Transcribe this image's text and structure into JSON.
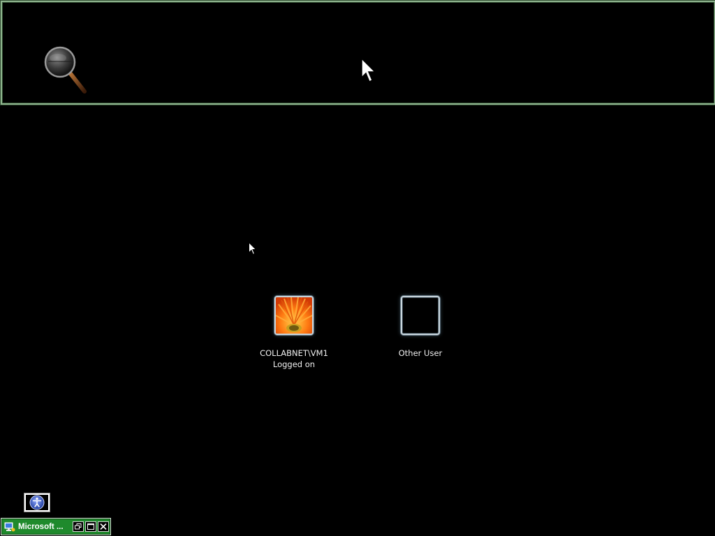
{
  "login": {
    "users": [
      {
        "name": "COLLABNET\\VM1",
        "status": "Logged on",
        "picture": "orange-flower"
      },
      {
        "name": "Other User",
        "status": "",
        "picture": "blank"
      }
    ]
  },
  "magnifier": {
    "icon": "magnifying-glass-icon"
  },
  "ease_of_access": {
    "icon": "ease-of-access-icon"
  },
  "taskbar_window": {
    "title": "Microsoft ...",
    "buttons": {
      "restore": "restore-icon",
      "maximize": "maximize-icon",
      "close": "close-icon"
    },
    "color": "#1f8a2c"
  }
}
